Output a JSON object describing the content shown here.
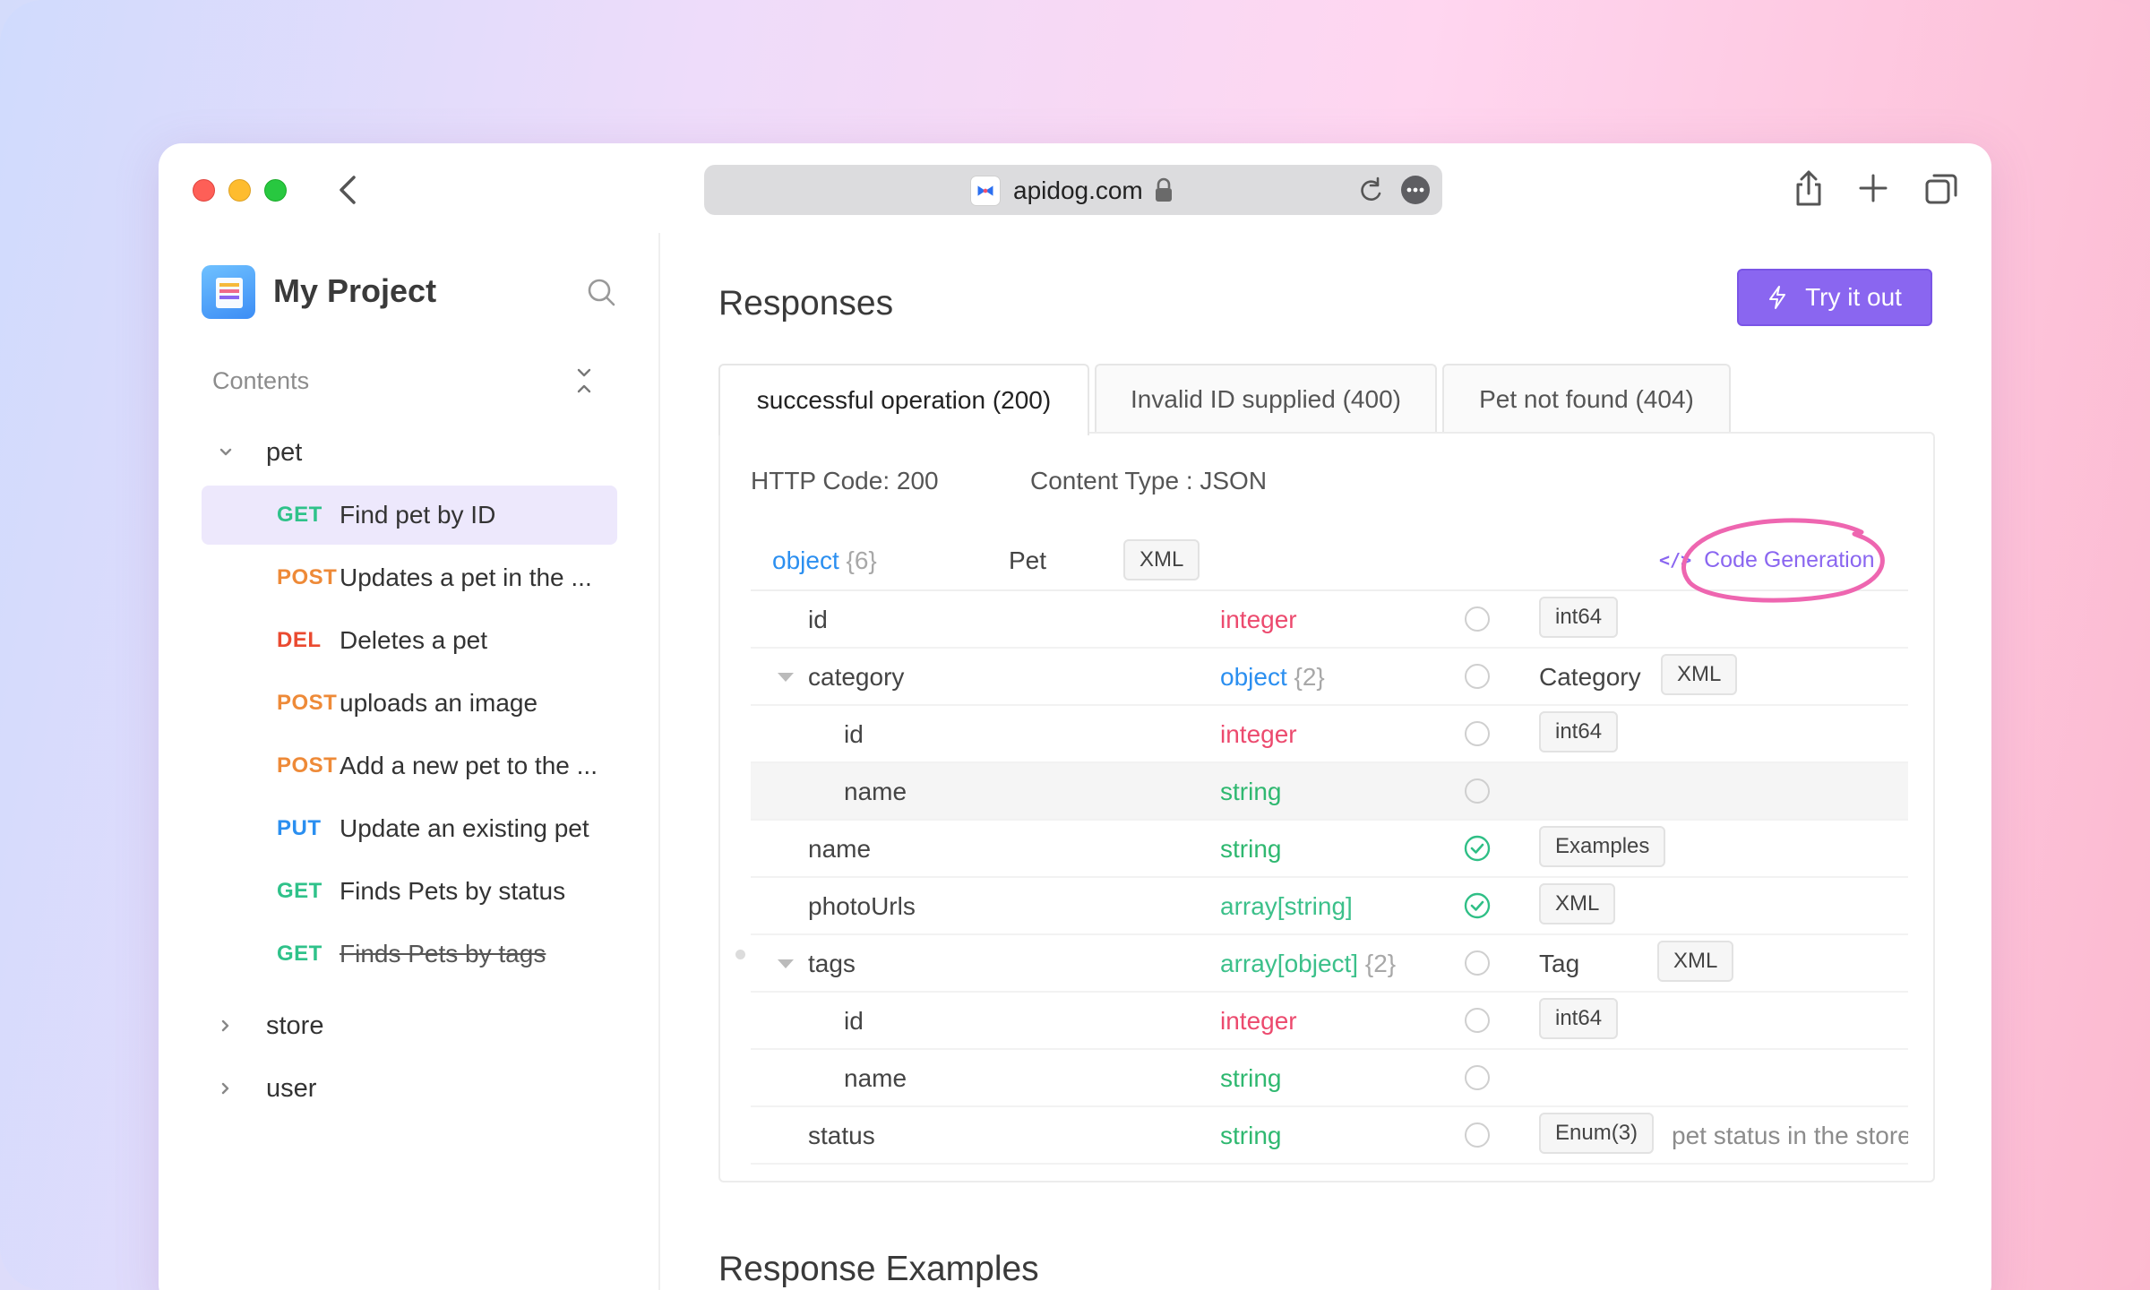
{
  "browser": {
    "url": "apidog.com"
  },
  "sidebar": {
    "project_title": "My Project",
    "contents_label": "Contents",
    "folders": {
      "pet": "pet",
      "store": "store",
      "user": "user"
    },
    "items": [
      {
        "method": "GET",
        "name": "Find pet by ID"
      },
      {
        "method": "POST",
        "name": "Updates a pet in the ..."
      },
      {
        "method": "DEL",
        "name": "Deletes a pet"
      },
      {
        "method": "POST",
        "name": "uploads an image"
      },
      {
        "method": "POST",
        "name": "Add a new pet to the ..."
      },
      {
        "method": "PUT",
        "name": "Update an existing pet"
      },
      {
        "method": "GET",
        "name": "Finds Pets by status"
      },
      {
        "method": "GET",
        "name": "Finds Pets by tags"
      }
    ]
  },
  "main": {
    "responses_title": "Responses",
    "try_button": "Try it out",
    "tabs": [
      {
        "label": "successful operation (200)"
      },
      {
        "label": "Invalid ID supplied (400)"
      },
      {
        "label": "Pet not found (404)"
      }
    ],
    "http_code": "HTTP Code: 200",
    "content_type": "Content Type : JSON",
    "root": {
      "type": "object",
      "count": "{6}",
      "model": "Pet",
      "xml": "XML",
      "codegen": "Code Generation",
      "codegen_icon": "</>"
    },
    "fields": [
      {
        "name": "id",
        "type": "integer",
        "extra": "int64"
      },
      {
        "name": "category",
        "type": "object",
        "count": "{2}",
        "model": "Category",
        "xml": "XML"
      },
      {
        "name": "id",
        "type": "integer",
        "extra": "int64"
      },
      {
        "name": "name",
        "type": "string"
      },
      {
        "name": "name",
        "type": "string",
        "extra": "Examples"
      },
      {
        "name": "photoUrls",
        "type": "array[string]",
        "extra": "XML"
      },
      {
        "name": "tags",
        "type": "array[object]",
        "count": "{2}",
        "model": "Tag",
        "xml": "XML"
      },
      {
        "name": "id",
        "type": "integer",
        "extra": "int64"
      },
      {
        "name": "name",
        "type": "string"
      },
      {
        "name": "status",
        "type": "string",
        "extra": "Enum(3)",
        "desc": "pet status in the store"
      }
    ],
    "examples_title": "Response Examples"
  },
  "colors": {
    "accent": "#8a66f0",
    "get": "#2fc28a",
    "post": "#ee8a38",
    "delete": "#ea4a30",
    "put": "#2b8ff0"
  }
}
